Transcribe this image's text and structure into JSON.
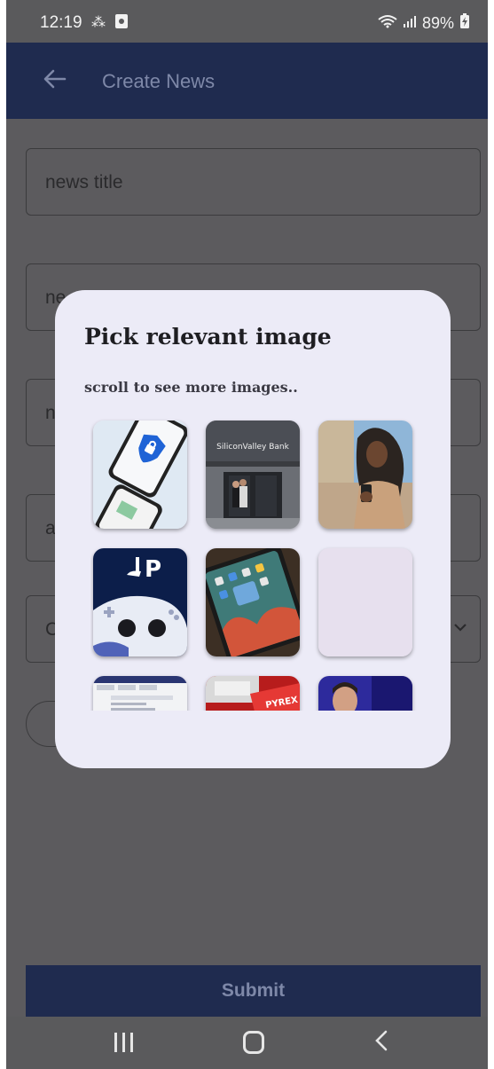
{
  "status_bar": {
    "time": "12:19",
    "battery": "89%"
  },
  "app_bar": {
    "title": "Create News"
  },
  "form": {
    "title_value": "news title",
    "field2_value": "ne",
    "field3_value": "n",
    "field4_value": "a",
    "field5_value": "C",
    "submit_label": "Submit"
  },
  "dialog": {
    "title": "Pick relevant image",
    "subtitle": "scroll to see more images..",
    "images": [
      {
        "name": "security-phone-image"
      },
      {
        "name": "silicon-valley-bank-image",
        "sign_text": "SiliconValley Bank"
      },
      {
        "name": "woman-phone-image"
      },
      {
        "name": "playstation-controller-image",
        "sign_text": "P"
      },
      {
        "name": "tablet-apps-image"
      },
      {
        "name": "placeholder-image"
      },
      {
        "name": "browser-screenshot-image"
      },
      {
        "name": "pyrex-image",
        "sign_text": "PYREX"
      },
      {
        "name": "politician-image"
      }
    ]
  },
  "colors": {
    "app_bar": "#1f2b4f",
    "overlay": "#5c5b5e",
    "dialog_bg": "#ecebf7"
  }
}
